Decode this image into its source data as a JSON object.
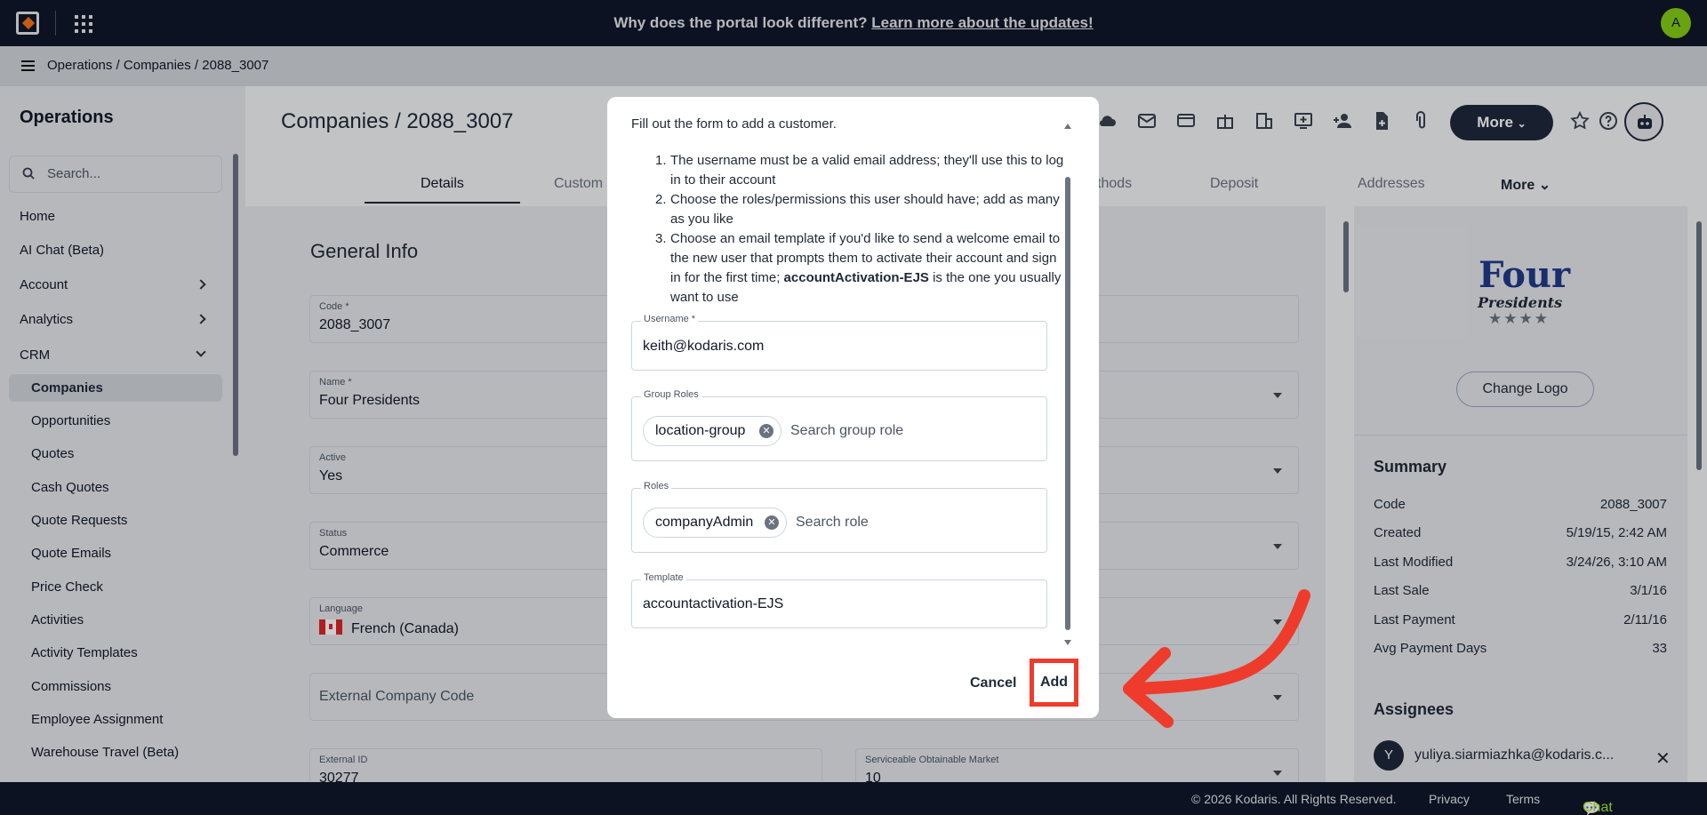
{
  "topbar": {
    "banner_text": "Why does the portal look different? ",
    "banner_link": "Learn more about the updates!",
    "avatar_initial": "A"
  },
  "breadcrumb": [
    "Operations",
    "Companies",
    "2088_3007"
  ],
  "sidebar": {
    "title": "Operations",
    "search_placeholder": "Search...",
    "items": [
      {
        "label": "Home"
      },
      {
        "label": "AI Chat (Beta)"
      },
      {
        "label": "Account"
      },
      {
        "label": "Analytics"
      },
      {
        "label": "CRM"
      },
      {
        "label": "Companies"
      },
      {
        "label": "Opportunities"
      },
      {
        "label": "Quotes"
      },
      {
        "label": "Cash Quotes"
      },
      {
        "label": "Quote Requests"
      },
      {
        "label": "Quote Emails"
      },
      {
        "label": "Price Check"
      },
      {
        "label": "Activities"
      },
      {
        "label": "Activity Templates"
      },
      {
        "label": "Commissions"
      },
      {
        "label": "Employee Assignment"
      },
      {
        "label": "Warehouse Travel (Beta)"
      }
    ]
  },
  "page": {
    "title": "Companies / 2088_3007",
    "more_label": "More",
    "tabs": [
      "Details",
      "Custom",
      "thods",
      "Deposit",
      "Addresses",
      "More"
    ]
  },
  "general_info": {
    "heading": "General Info",
    "code_label": "Code *",
    "code_value": "2088_3007",
    "name_label": "Name *",
    "name_value": "Four Presidents",
    "active_label": "Active",
    "active_value": "Yes",
    "status_label": "Status",
    "status_value": "Commerce",
    "language_label": "Language",
    "language_value": "French (Canada)",
    "external_code_placeholder": "External Company Code",
    "external_id_label": "External ID",
    "external_id_value": "30277",
    "som_label": "Serviceable Obtainable Market",
    "som_value": "10"
  },
  "right_panel": {
    "logo_line1": "Four",
    "logo_line2": "Presidents",
    "logo_stars": "★★★★",
    "change_logo": "Change Logo",
    "summary_title": "Summary",
    "summary": [
      {
        "label": "Code",
        "value": "2088_3007"
      },
      {
        "label": "Created",
        "value": "5/19/15, 2:42 AM"
      },
      {
        "label": "Last Modified",
        "value": "3/24/26, 3:10 AM"
      },
      {
        "label": "Last Sale",
        "value": "3/1/16"
      },
      {
        "label": "Last Payment",
        "value": "2/11/16"
      },
      {
        "label": "Avg Payment Days",
        "value": "33"
      }
    ],
    "assignees_title": "Assignees",
    "assignee_initial": "Y",
    "assignee_email": "yuliya.siarmiazhka@kodaris.c..."
  },
  "footer": {
    "copyright": "© 2026 Kodaris. All Rights Reserved.",
    "privacy": "Privacy",
    "terms": "Terms",
    "chat": "Chat with us"
  },
  "modal": {
    "intro": "Fill out the form to add a customer.",
    "steps": [
      {
        "n": "1.",
        "text": "The username must be a valid email address; they'll use this to log in to their account"
      },
      {
        "n": "2.",
        "text": "Choose the roles/permissions this user should have; add as many as you like"
      },
      {
        "n": "3.",
        "text_a": "Choose an email template if you'd like to send a welcome email to the new user that prompts them to activate their account and sign in for the first time; ",
        "text_b": "accountActivation-EJS",
        "text_c": " is the one you usually want to use"
      }
    ],
    "username_label": "Username *",
    "username_value": "keith@kodaris.com",
    "group_roles_label": "Group Roles",
    "group_role_chip": "location-group",
    "group_role_placeholder": "Search group role",
    "roles_label": "Roles",
    "role_chip": "companyAdmin",
    "role_placeholder": "Search role",
    "template_label": "Template",
    "template_value": "accountactivation-EJS",
    "cancel": "Cancel",
    "add": "Add"
  },
  "colors": {
    "highlight": "#ef3b2c",
    "navy": "#0f172a",
    "accent_green": "#84cc16"
  }
}
